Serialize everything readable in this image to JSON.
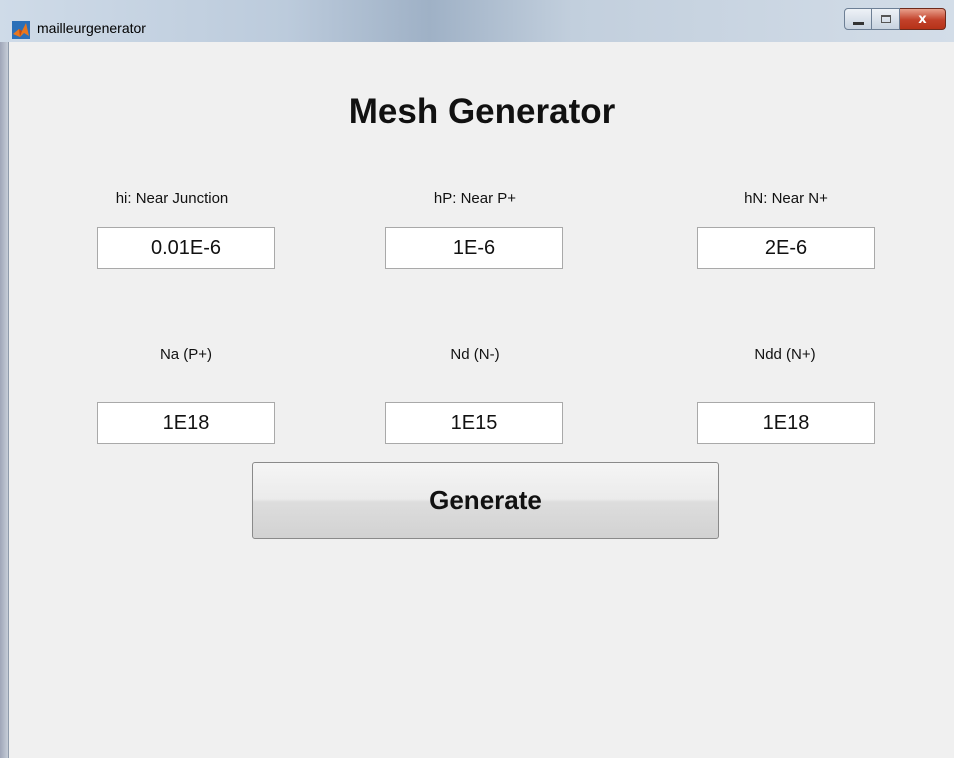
{
  "window": {
    "title": "mailleurgenerator",
    "close_label": "x"
  },
  "form": {
    "heading": "Mesh Generator",
    "fields": [
      {
        "label": "hi: Near Junction",
        "value": "0.01E-6"
      },
      {
        "label": "hP: Near P+",
        "value": "1E-6"
      },
      {
        "label": "hN: Near N+",
        "value": "2E-6"
      },
      {
        "label": "Na (P+)",
        "value": "1E18"
      },
      {
        "label": "Nd (N-)",
        "value": "1E15"
      },
      {
        "label": "Ndd (N+)",
        "value": "1E18"
      }
    ],
    "generate_label": "Generate"
  },
  "icons": {
    "app": "matlab-icon",
    "minimize": "minimize-icon",
    "maximize": "maximize-icon",
    "close": "close-icon"
  },
  "colors": {
    "client_background": "#f0f0f0",
    "close_button": "#c2412a",
    "app_icon_orange": "#e8761e",
    "app_icon_blue": "#2a6fb8"
  }
}
